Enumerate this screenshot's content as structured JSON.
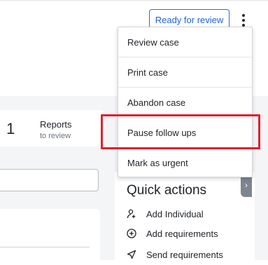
{
  "header": {
    "ready_label": "Ready for review"
  },
  "reports": {
    "count": "1",
    "title": "Reports",
    "subtitle": "to review"
  },
  "menu": {
    "items": [
      {
        "label": "Review case"
      },
      {
        "label": "Print case"
      },
      {
        "label": "Abandon case"
      },
      {
        "label": "Pause follow ups"
      },
      {
        "label": "Mark as urgent"
      }
    ]
  },
  "quick_actions": {
    "title": "Quick actions",
    "items": [
      {
        "label": "Add Individual",
        "icon": "add-person-icon"
      },
      {
        "label": "Add requirements",
        "icon": "plus-circle-icon"
      },
      {
        "label": "Send requirements",
        "icon": "send-icon"
      }
    ]
  },
  "colors": {
    "accent": "#1f63d6",
    "highlight": "#e0212e"
  }
}
